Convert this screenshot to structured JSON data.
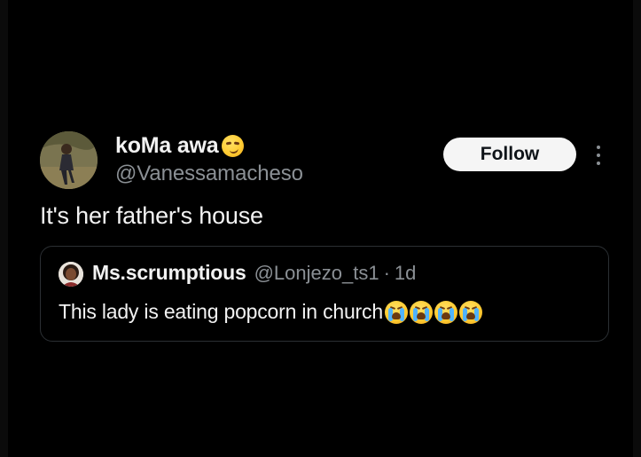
{
  "tweet": {
    "author": {
      "name": "koMa awa",
      "name_emoji": "smirk-emoji",
      "handle": "@Vanessamacheso",
      "avatar": "avatar-photo"
    },
    "follow_label": "Follow",
    "more_icon": "more-options-icon",
    "text": "It's her father's house"
  },
  "quoted_tweet": {
    "author": {
      "name": "Ms.scrumptious",
      "handle": "@Lonjezo_ts1",
      "avatar": "avatar-photo"
    },
    "separator": "·",
    "time": "1d",
    "text": "This lady is eating popcorn in church",
    "trailing_emojis": [
      "sob-emoji",
      "sob-emoji",
      "sob-emoji",
      "sob-emoji"
    ]
  },
  "colors": {
    "background": "#000000",
    "primary_text": "#f2f2f2",
    "secondary_text": "#8b9095",
    "border": "#2b2f33",
    "follow_button_bg": "#f5f5f5",
    "follow_button_text": "#0f1419"
  }
}
